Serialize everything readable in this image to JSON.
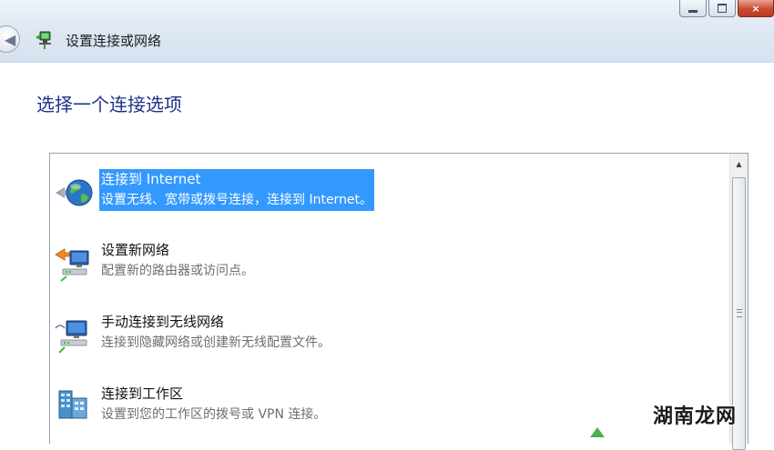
{
  "window": {
    "title": "设置连接或网络",
    "minimize_icon": "minimize-icon",
    "maximize_icon": "maximize-icon",
    "close_label": "×"
  },
  "nav": {
    "back_icon": "back-arrow-icon",
    "back_glyph": "◀"
  },
  "page": {
    "heading": "选择一个连接选项"
  },
  "options": [
    {
      "title": "连接到 Internet",
      "description": "设置无线、宽带或拨号连接，连接到 Internet。",
      "icon": "globe-icon",
      "selected": true
    },
    {
      "title": "设置新网络",
      "description": "配置新的路由器或访问点。",
      "icon": "new-network-icon",
      "selected": false
    },
    {
      "title": "手动连接到无线网络",
      "description": "连接到隐藏网络或创建新无线配置文件。",
      "icon": "wireless-network-icon",
      "selected": false
    },
    {
      "title": "连接到工作区",
      "description": "设置到您的工作区的拨号或 VPN 连接。",
      "icon": "workplace-icon",
      "selected": false
    }
  ],
  "scrollbar": {
    "up_arrow": "▲"
  },
  "watermark": "湖南龙网",
  "colors": {
    "selection": "#3399ff",
    "heading": "#1e3287"
  }
}
